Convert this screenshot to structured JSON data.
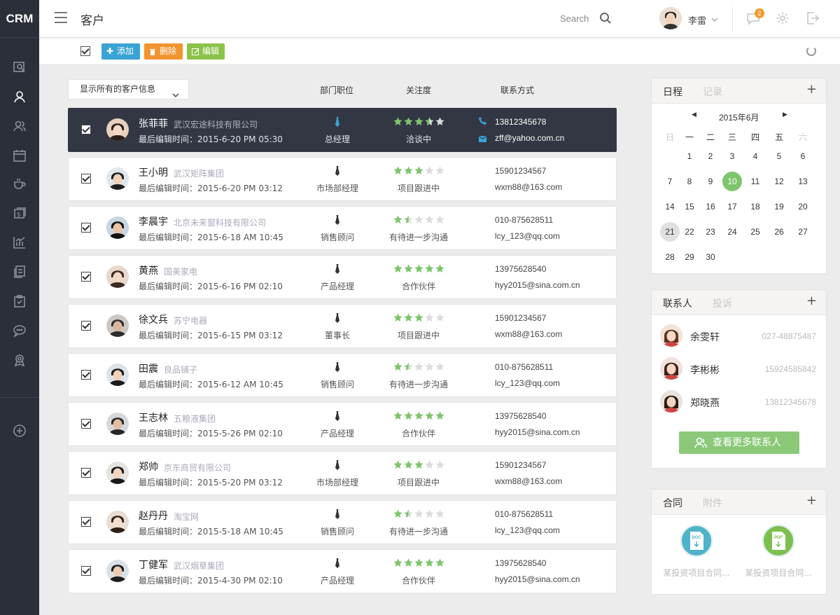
{
  "app": {
    "logo": "CRM",
    "page_title": "客户"
  },
  "header": {
    "search_label": "Search",
    "user_name": "李雷",
    "notification_count": "2"
  },
  "toolbar": {
    "add_label": "添加",
    "delete_label": "删除",
    "edit_label": "编辑"
  },
  "list": {
    "filter_label": "显示所有的客户信息",
    "columns": {
      "position": "部门职位",
      "attention": "关注度",
      "contact": "联系方式"
    },
    "rows": [
      {
        "name": "张菲菲",
        "company": "武汉宏途科技有限公司",
        "edited": "最后编辑时间：2015-6-20 PM 05:30",
        "position": "总经理",
        "rating": 3.5,
        "status": "洽谈中",
        "phone": "13812345678",
        "email": "zff@yahoo.com.cn",
        "active": true
      },
      {
        "name": "王小明",
        "company": "武汉矩阵集团",
        "edited": "最后编辑时间：2015-6-20 PM 03:12",
        "position": "市场部经理",
        "rating": 3,
        "status": "项目跟进中",
        "phone": "15901234567",
        "email": "wxm88@163.com"
      },
      {
        "name": "李晨宇",
        "company": "北京未来窗科技有限公司",
        "edited": "最后编辑时间：2015-6-18 AM 10:45",
        "position": "销售顾问",
        "rating": 1.5,
        "status": "有待进一步沟通",
        "phone": "010-875628511",
        "email": "lcy_123@qq.com"
      },
      {
        "name": "黄燕",
        "company": "国美家电",
        "edited": "最后编辑时间：2015-6-16 PM 02:10",
        "position": "产品经理",
        "rating": 5,
        "status": "合作伙伴",
        "phone": "13975628540",
        "email": "hyy2015@sina.com.cn"
      },
      {
        "name": "徐文兵",
        "company": "苏宁电器",
        "edited": "最后编辑时间：2015-6-15 PM 03:12",
        "position": "董事长",
        "rating": 3,
        "status": "项目跟进中",
        "phone": "15901234567",
        "email": "wxm88@163.com"
      },
      {
        "name": "田震",
        "company": "良品铺子",
        "edited": "最后编辑时间：2015-6-12 AM 10:45",
        "position": "销售顾问",
        "rating": 1.5,
        "status": "有待进一步沟通",
        "phone": "010-875628511",
        "email": "lcy_123@qq.com"
      },
      {
        "name": "王志林",
        "company": "五粮液集团",
        "edited": "最后编辑时间：2015-5-26 PM 02:10",
        "position": "产品经理",
        "rating": 5,
        "status": "合作伙伴",
        "phone": "13975628540",
        "email": "hyy2015@sina.com.cn"
      },
      {
        "name": "郑帅",
        "company": "京东商贸有限公司",
        "edited": "最后编辑时间：2015-5-20 PM 03:12",
        "position": "市场部经理",
        "rating": 3,
        "status": "项目跟进中",
        "phone": "15901234567",
        "email": "wxm88@163.com"
      },
      {
        "name": "赵丹丹",
        "company": "淘宝网",
        "edited": "最后编辑时间：2015-5-18 AM 10:45",
        "position": "销售顾问",
        "rating": 1.5,
        "status": "有待进一步沟通",
        "phone": "010-875628511",
        "email": "lcy_123@qq.com"
      },
      {
        "name": "丁健军",
        "company": "武汉烟草集团",
        "edited": "最后编辑时间：2015-4-30 PM 02:10",
        "position": "产品经理",
        "rating": 5,
        "status": "合作伙伴",
        "phone": "13975628540",
        "email": "hyy2015@sina.com.cn"
      }
    ]
  },
  "schedule": {
    "tab_active": "日程",
    "tab_inactive": "记录",
    "plus": "+",
    "month": "2015年6月",
    "prev": "◀",
    "next": "▶",
    "weekdays": [
      "日",
      "一",
      "二",
      "三",
      "四",
      "五",
      "六"
    ],
    "days": [
      [
        "",
        "1",
        "2",
        "3",
        "4",
        "5",
        "6"
      ],
      [
        "7",
        "8",
        "9",
        "10",
        "11",
        "12",
        "13"
      ],
      [
        "14",
        "15",
        "16",
        "17",
        "18",
        "19",
        "20"
      ],
      [
        "21",
        "22",
        "23",
        "24",
        "25",
        "26",
        "27"
      ],
      [
        "28",
        "29",
        "30",
        "",
        "",
        "",
        ""
      ]
    ],
    "selected_day": "10",
    "today": "21"
  },
  "contacts": {
    "tab_active": "联系人",
    "tab_inactive": "投诉",
    "plus": "+",
    "items": [
      {
        "name": "余雯轩",
        "phone": "027-48875487"
      },
      {
        "name": "李彬彬",
        "phone": "15924585842"
      },
      {
        "name": "郑晓燕",
        "phone": "13812345678"
      }
    ],
    "more_label": "查看更多联系人"
  },
  "contracts": {
    "tab_active": "合同",
    "tab_inactive": "附件",
    "plus": "+",
    "files": [
      {
        "name": "某投资项目合同...",
        "type": "DOC",
        "color": "#4fb3c9"
      },
      {
        "name": "某投资项目合同...",
        "type": "PDF",
        "color": "#7dbf4e"
      }
    ]
  },
  "colors": {
    "accent_green": "#8bc979",
    "add_blue": "#3aa3d6",
    "delete_orange": "#f29530",
    "edit_green": "#8bc34a",
    "sidebar": "#2b2f38",
    "star_on": "#7dc56b",
    "star_off": "#dcdcdc"
  }
}
